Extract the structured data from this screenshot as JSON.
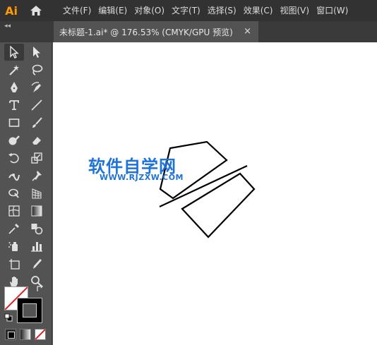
{
  "app": {
    "logo": "Ai"
  },
  "menu": {
    "items": [
      "文件(F)",
      "编辑(E)",
      "对象(O)",
      "文字(T)",
      "选择(S)",
      "效果(C)",
      "视图(V)",
      "窗口(W)"
    ]
  },
  "document_tab": {
    "label": "未标题-1.ai* @ 176.53% (CMYK/GPU 预览)",
    "close": "×"
  },
  "toolbar": {
    "collapse": "◂◂",
    "tools": [
      {
        "name": "selection-tool-icon",
        "active": true
      },
      {
        "name": "direct-selection-tool-icon"
      },
      {
        "name": "magic-wand-tool-icon"
      },
      {
        "name": "lasso-tool-icon"
      },
      {
        "name": "pen-tool-icon"
      },
      {
        "name": "curvature-tool-icon"
      },
      {
        "name": "type-tool-icon"
      },
      {
        "name": "line-segment-tool-icon"
      },
      {
        "name": "rectangle-tool-icon"
      },
      {
        "name": "paintbrush-tool-icon"
      },
      {
        "name": "shaper-tool-icon"
      },
      {
        "name": "eraser-tool-icon"
      },
      {
        "name": "rotate-tool-icon"
      },
      {
        "name": "scale-tool-icon"
      },
      {
        "name": "width-tool-icon"
      },
      {
        "name": "puppet-warp-tool-icon"
      },
      {
        "name": "shape-builder-tool-icon"
      },
      {
        "name": "perspective-grid-tool-icon"
      },
      {
        "name": "mesh-tool-icon"
      },
      {
        "name": "gradient-tool-icon"
      },
      {
        "name": "eyedropper-tool-icon"
      },
      {
        "name": "blend-tool-icon"
      },
      {
        "name": "symbol-sprayer-tool-icon"
      },
      {
        "name": "column-graph-tool-icon"
      },
      {
        "name": "artboard-tool-icon"
      },
      {
        "name": "slice-tool-icon"
      },
      {
        "name": "hand-tool-icon"
      },
      {
        "name": "zoom-tool-icon"
      }
    ],
    "fill_color": "#ffffff",
    "stroke_color": "#000000"
  },
  "watermark": {
    "title": "软件自学网",
    "url": "WWW.RJZXW.COM",
    "color": "#1e73d8"
  }
}
